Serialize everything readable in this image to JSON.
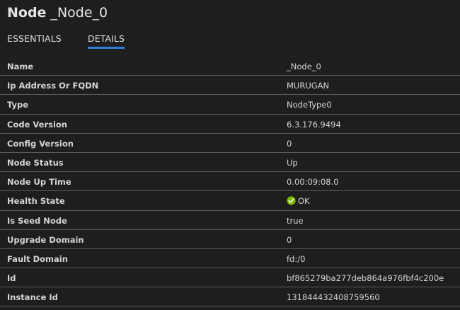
{
  "header": {
    "kind": "Node",
    "name": "_Node_0"
  },
  "tabs": [
    {
      "label": "ESSENTIALS"
    },
    {
      "label": "DETAILS"
    }
  ],
  "details": [
    {
      "key": "Name",
      "value": "_Node_0"
    },
    {
      "key": "Ip Address Or FQDN",
      "value": "MURUGAN"
    },
    {
      "key": "Type",
      "value": "NodeType0"
    },
    {
      "key": "Code Version",
      "value": "6.3.176.9494"
    },
    {
      "key": "Config Version",
      "value": "0"
    },
    {
      "key": "Node Status",
      "value": "Up"
    },
    {
      "key": "Node Up Time",
      "value": "0.00:09:08.0"
    },
    {
      "key": "Health State",
      "value": "OK",
      "icon": "check-circle-icon"
    },
    {
      "key": "Is Seed Node",
      "value": "true"
    },
    {
      "key": "Upgrade Domain",
      "value": "0"
    },
    {
      "key": "Fault Domain",
      "value": "fd:/0"
    },
    {
      "key": "Id",
      "value": "bf865279ba277deb864a976fbf4c200e"
    },
    {
      "key": "Instance Id",
      "value": "131844432408759560"
    }
  ],
  "colors": {
    "background": "#1e1e1e",
    "accent": "#2f7ed8",
    "ok": "#7fba00"
  }
}
